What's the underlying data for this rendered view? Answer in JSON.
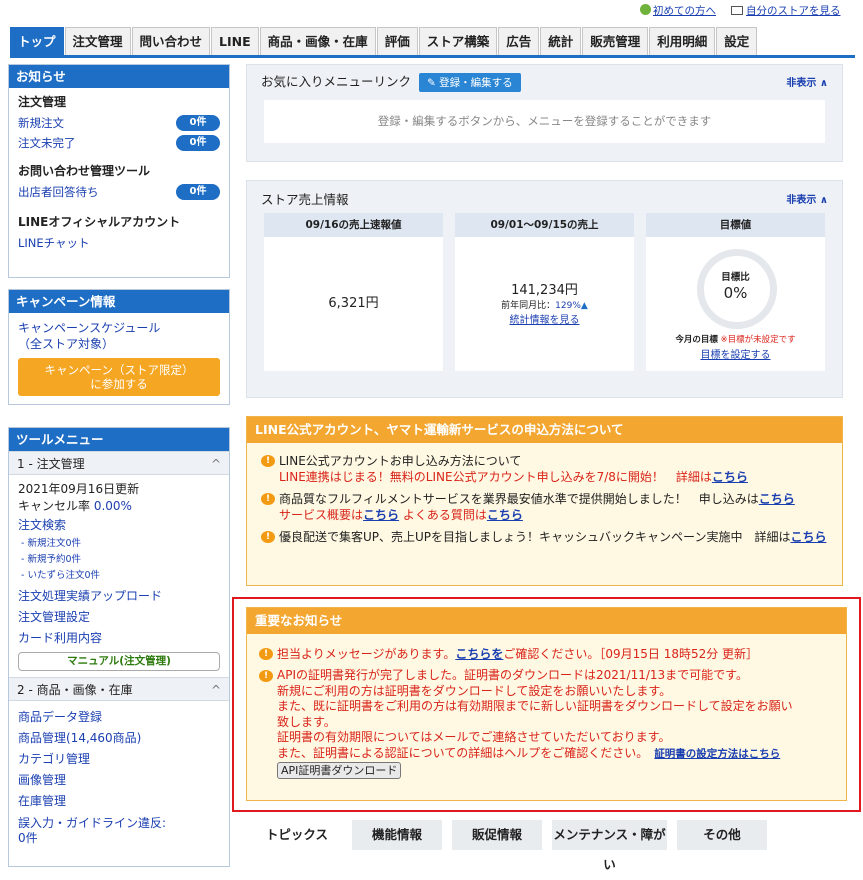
{
  "topbar": {
    "first": "初めての方へ",
    "store": "自分のストアを見る"
  },
  "tabs": [
    "トップ",
    "注文管理",
    "問い合わせ",
    "LINE",
    "商品・画像・在庫",
    "評価",
    "ストア構築",
    "広告",
    "統計",
    "販売管理",
    "利用明細",
    "設定"
  ],
  "notice": {
    "title": "お知らせ",
    "order": "注文管理",
    "new_order": "新規注文",
    "new_count": "0件",
    "unfinished": "注文未完了",
    "unf_count": "0件",
    "inquiry": "お問い合わせ管理ツール",
    "waiting": "出店者回答待ち",
    "wait_count": "0件",
    "line": "LINEオフィシャルアカウント",
    "line_chat": "LINEチャット"
  },
  "campaign": {
    "title": "キャンペーン情報",
    "schedule1": "キャンペーンスケジュール",
    "schedule2": "（全ストア対象）",
    "btn1": "キャンペーン（ストア限定）",
    "btn2": "に参加する"
  },
  "tools": {
    "title": "ツールメニュー",
    "g1": "1 - 注文管理",
    "updated": "2021年09月16日更新",
    "cancel_label": "キャンセル率 ",
    "cancel_val": "0.00%",
    "search": "注文検索",
    "s1": "- 新規注文0件",
    "s2": "- 新規予約0件",
    "s3": "- いたずら注文0件",
    "upload": "注文処理実績アップロード",
    "setting": "注文管理設定",
    "card": "カード利用内容",
    "manual": "マニュアル(注文管理)",
    "g2": "2 - 商品・画像・在庫",
    "p1": "商品データ登録",
    "p2": "商品管理(14,460商品)",
    "p3": "カテゴリ管理",
    "p4": "画像管理",
    "p5": "在庫管理",
    "p6": "誤入力・ガイドライン違反:",
    "p7": "0件"
  },
  "fav": {
    "title": "お気に入りメニューリンク",
    "btn": "登録・編集する",
    "hide": "非表示",
    "empty": "登録・編集するボタンから、メニューを登録することができます"
  },
  "sales": {
    "title": "ストア売上情報",
    "hide": "非表示",
    "c1": "09/16の売上速報値",
    "v1": "6,321円",
    "c2": "09/01～09/15の売上",
    "v2": "141,234円",
    "yoy_label": "前年同月比：",
    "yoy": "129%",
    "stat_link": "統計情報を見る",
    "c3": "目標値",
    "goal_label": "目標比",
    "goal_val": "0%",
    "month_goal": "今月の目標",
    "unset": "※目標が未設定です",
    "set_link": "目標を設定する"
  },
  "line_notice": {
    "title": "LINE公式アカウント、ヤマト運輸新サービスの申込方法について",
    "i1a": "LINE公式アカウントお申し込み方法について",
    "i1b": "LINE連携はじまる！無料のLINE公式アカウント申し込みを7/8に開始！　詳細は",
    "here": "こちら",
    "i2a": "商品質なフルフィルメントサービスを業界最安値水準で提供開始しました！　申し込みは",
    "i2b": "サービス概要は",
    "i2c": "よくある質問は",
    "i3a": "優良配送で集客UP、売上UPを目指しましょう！キャッシュバックキャンペーン実施中　詳細は",
    "i3b": "こちら",
    "i3c": "ら"
  },
  "important": {
    "title": "重要なお知らせ",
    "m1a": "担当よりメッセージがあります。",
    "m1link": "こちらを",
    "m1b": "ご確認ください。［09月15日 18時52分 更新］",
    "m2": [
      "APIの証明書発行が完了しました。証明書のダウンロードは2021/11/13まで可能です。",
      "新規にご利用の方は証明書をダウンロードして設定をお願いいたします。",
      "また、既に証明書をご利用の方は有効期限までに新しい証明書をダウンロードして設定をお願い",
      "致します。",
      "証明書の有効期限についてはメールでご連絡させていただいております。"
    ],
    "m2last": "また、証明書による認証についての詳細はヘルプをご確認ください。",
    "m2link": "証明書の設定方法はこちら",
    "dl": "API証明書ダウンロード"
  },
  "bottom_tabs": [
    "トピックス",
    "機能情報",
    "販促情報",
    "メンテナンス・障がい",
    "その他"
  ],
  "colors": {
    "brand": "#1e6ec5",
    "orange": "#f3a630",
    "alert": "#e0191f"
  }
}
